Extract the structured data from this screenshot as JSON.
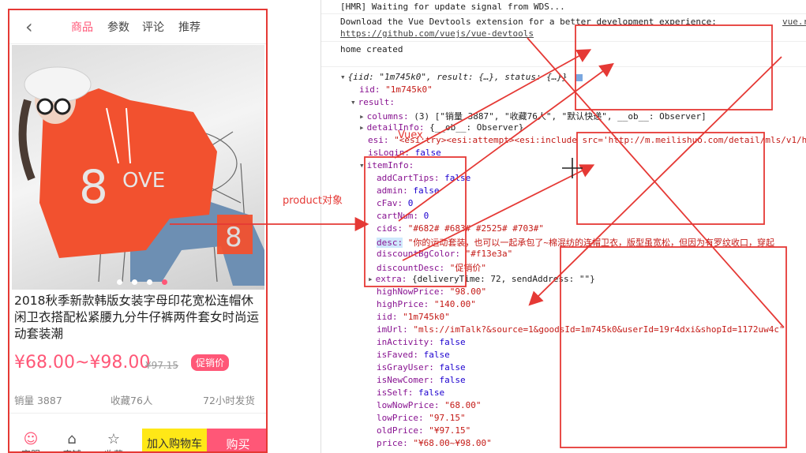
{
  "phone": {
    "nav": {
      "tabs": [
        "商品",
        "参数",
        "评论",
        "推荐"
      ],
      "active_index": 0
    },
    "carousel": {
      "dots": 4,
      "active": 3
    },
    "title": "2018秋季新款韩版女装字母印花宽松连帽休闲卫衣搭配松紧腰九分牛仔裤两件套女时尚运动套装潮",
    "price": "¥68.00~¥98.00",
    "old_price": "¥97.15",
    "discount_badge": "促销价",
    "columns": [
      "销量 3887",
      "收藏76人",
      "72小时发货"
    ],
    "bottom_bar": {
      "service": "客服",
      "shop": "店铺",
      "favorite": "收藏",
      "add_cart": "加入购物车",
      "buy": "购买"
    }
  },
  "console": {
    "hmr": "[HMR] Waiting for update signal from WDS...",
    "devtools_line1": "Download the Vue Devtools extension for a better development experience:",
    "devtools_link": "https://github.com/vuejs/vue-devtools",
    "source_link": "vue.r",
    "home_created": "home created",
    "tree": {
      "root": "{iid: \"1m745k0\", result: {…}, status: {…}}",
      "iid": "\"1m745k0\"",
      "result_key": "result:",
      "columns_key": "columns:",
      "columns_val": "(3) [\"销量 3887\", \"收藏76人\", \"默认快递\", __ob__: Observer]",
      "detailInfo_key": "detailInfo:",
      "detailInfo_val": "{__ob__: Observer}",
      "esi_key": "esi:",
      "esi_val": "\"<esi:try><esi:attempt><esi:include src='http://m.meilishuo.com/detail/mls/v1/h",
      "isLogin_key": "isLogin:",
      "isLogin_val": "false",
      "itemInfo_key": "itemInfo:",
      "item_fields": [
        {
          "k": "addCartTips:",
          "v": "false",
          "t": "n"
        },
        {
          "k": "admin:",
          "v": "false",
          "t": "n"
        },
        {
          "k": "cFav:",
          "v": "0",
          "t": "n"
        },
        {
          "k": "cartNum:",
          "v": "0",
          "t": "n"
        },
        {
          "k": "cids:",
          "v": "\"#682# #683# #2525# #703#\"",
          "t": "s"
        },
        {
          "k": "desc:",
          "v": "\"你的运动套装，也可以一起承包了~棉混纺的连帽卫衣，版型虽宽松，但因为有罗纹收口，穿起",
          "t": "s"
        },
        {
          "k": "discountBgColor:",
          "v": "\"#f13e3a\"",
          "t": "s"
        },
        {
          "k": "discountDesc:",
          "v": "\"促销价\"",
          "t": "s"
        },
        {
          "k": "extra:",
          "v": "{deliveryTime: 72, sendAddress: \"\"}",
          "t": "p"
        },
        {
          "k": "highNowPrice:",
          "v": "\"98.00\"",
          "t": "s"
        },
        {
          "k": "highPrice:",
          "v": "\"140.00\"",
          "t": "s"
        },
        {
          "k": "iid:",
          "v": "\"1m745k0\"",
          "t": "s"
        },
        {
          "k": "imUrl:",
          "v": "\"mls://imTalk?&source=1&goodsId=1m745k0&userId=19r4dxi&shopId=1172uw4c\"",
          "t": "s"
        },
        {
          "k": "inActivity:",
          "v": "false",
          "t": "n"
        },
        {
          "k": "isFaved:",
          "v": "false",
          "t": "n"
        },
        {
          "k": "isGrayUser:",
          "v": "false",
          "t": "n"
        },
        {
          "k": "isNewComer:",
          "v": "false",
          "t": "n"
        },
        {
          "k": "isSelf:",
          "v": "false",
          "t": "n"
        },
        {
          "k": "lowNowPrice:",
          "v": "\"68.00\"",
          "t": "s"
        },
        {
          "k": "lowPrice:",
          "v": "\"97.15\"",
          "t": "s"
        },
        {
          "k": "oldPrice:",
          "v": "\"¥97.15\"",
          "t": "s"
        },
        {
          "k": "price:",
          "v": "\"¥68.00~¥98.00\"",
          "t": "s"
        }
      ]
    }
  },
  "annotations": {
    "product_label": "product对象",
    "vuex_label": "Vuex"
  },
  "colors": {
    "accent": "#ff5777",
    "annotation": "#e53935",
    "cart": "#ffe817"
  }
}
